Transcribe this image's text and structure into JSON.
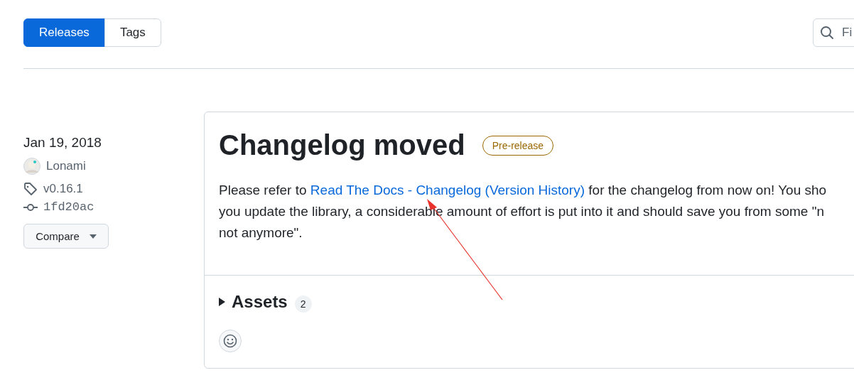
{
  "tabs": [
    {
      "label": "Releases",
      "selected": true
    },
    {
      "label": "Tags",
      "selected": false
    }
  ],
  "search": {
    "placeholder": "Fi"
  },
  "release": {
    "date": "Jan 19, 2018",
    "author": "Lonami",
    "tag": "v0.16.1",
    "commit": "1fd20ac",
    "compare_button": "Compare",
    "title": "Changelog moved",
    "badge": "Pre-release",
    "notes": [
      {
        "before": "Please refer to ",
        "link": "Read The Docs - Changelog (Version History)",
        "after": " for the changelog from now on! You sho"
      },
      {
        "before": "you update the library, a considerable amount of effort is put into it and should save you from some \"n"
      },
      {
        "before": "not anymore\"."
      }
    ],
    "assets": {
      "label": "Assets",
      "count": "2",
      "expanded": false
    }
  }
}
